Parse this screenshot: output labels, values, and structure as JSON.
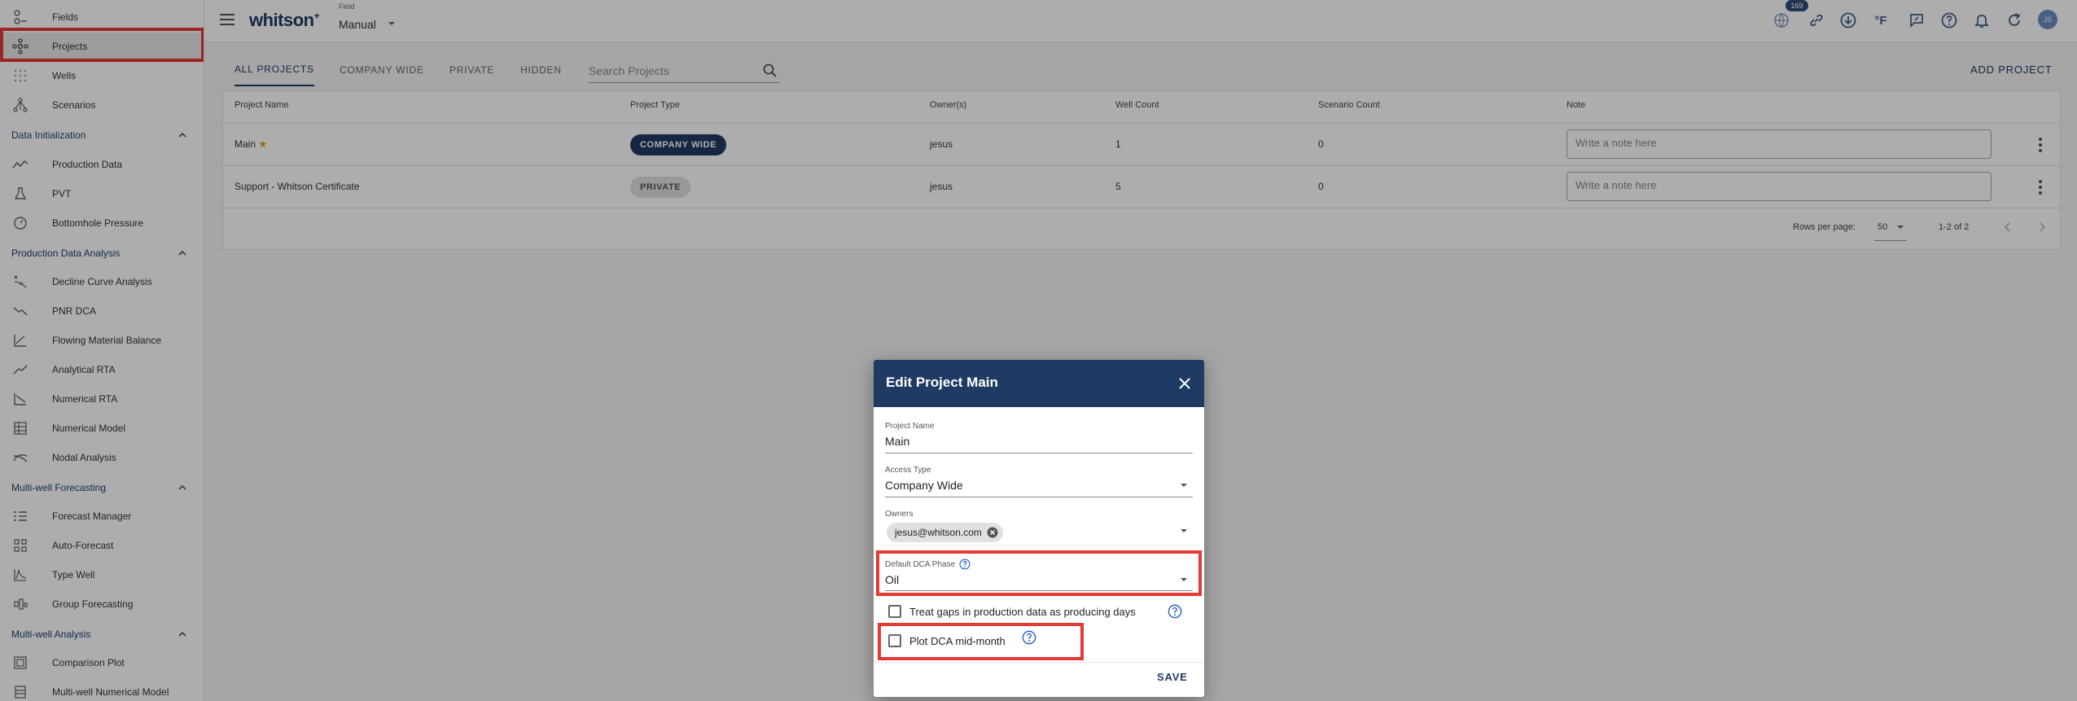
{
  "colors": {
    "primary": "#1f3a63",
    "highlight": "#e53935",
    "star": "#d4a017"
  },
  "sidebar": {
    "top_items": [
      {
        "label": "Fields",
        "icon": "fields-icon"
      },
      {
        "label": "Projects",
        "icon": "projects-icon"
      },
      {
        "label": "Wells",
        "icon": "wells-icon"
      },
      {
        "label": "Scenarios",
        "icon": "scenarios-icon"
      }
    ],
    "sections": [
      {
        "title": "Data Initialization",
        "items": [
          {
            "label": "Production Data",
            "icon": "production-data-icon"
          },
          {
            "label": "PVT",
            "icon": "pvt-flask-icon"
          },
          {
            "label": "Bottomhole Pressure",
            "icon": "pressure-gauge-icon"
          }
        ]
      },
      {
        "title": "Production Data Analysis",
        "items": [
          {
            "label": "Decline Curve Analysis",
            "icon": "decline-curve-icon"
          },
          {
            "label": "PNR DCA",
            "icon": "pnr-dca-icon"
          },
          {
            "label": "Flowing Material Balance",
            "icon": "material-balance-icon"
          },
          {
            "label": "Analytical RTA",
            "icon": "analytical-rta-icon"
          },
          {
            "label": "Numerical RTA",
            "icon": "numerical-rta-icon"
          },
          {
            "label": "Numerical Model",
            "icon": "numerical-model-icon"
          },
          {
            "label": "Nodal Analysis",
            "icon": "nodal-analysis-icon"
          }
        ]
      },
      {
        "title": "Multi-well Forecasting",
        "items": [
          {
            "label": "Forecast Manager",
            "icon": "forecast-manager-icon"
          },
          {
            "label": "Auto-Forecast",
            "icon": "auto-forecast-icon"
          },
          {
            "label": "Type Well",
            "icon": "type-well-icon"
          },
          {
            "label": "Group Forecasting",
            "icon": "group-forecasting-icon"
          }
        ]
      },
      {
        "title": "Multi-well Analysis",
        "items": [
          {
            "label": "Comparison Plot",
            "icon": "comparison-plot-icon"
          },
          {
            "label": "Multi-well Numerical Model",
            "icon": "multiwell-model-icon"
          }
        ]
      }
    ]
  },
  "header": {
    "logo": "whitson",
    "logo_sup": "+",
    "field_caption": "Field",
    "field_value": "Manual",
    "notification_count": "169",
    "temperature_unit": "°F",
    "avatar_initials": "JS"
  },
  "tabs": [
    "ALL PROJECTS",
    "COMPANY WIDE",
    "PRIVATE",
    "HIDDEN"
  ],
  "search": {
    "placeholder": "Search Projects"
  },
  "add_project_label": "ADD PROJECT",
  "table": {
    "columns": [
      "Project Name",
      "Project Type",
      "Owner(s)",
      "Well Count",
      "Scenario Count",
      "Note"
    ],
    "rows": [
      {
        "name": "Main",
        "starred": true,
        "type": "COMPANY WIDE",
        "owner": "jesus",
        "well_count": "1",
        "scenario_count": "0",
        "note_placeholder": "Write a note here"
      },
      {
        "name": "Support - Whitson Certificate",
        "starred": false,
        "type": "PRIVATE",
        "owner": "jesus",
        "well_count": "5",
        "scenario_count": "0",
        "note_placeholder": "Write a note here"
      }
    ],
    "rows_per_page_label": "Rows per page:",
    "rows_per_page": "50",
    "page_range": "1-2 of 2"
  },
  "dialog": {
    "title": "Edit Project Main",
    "project_name_label": "Project Name",
    "project_name_value": "Main",
    "access_type_label": "Access Type",
    "access_type_value": "Company Wide",
    "owners_label": "Owners",
    "owner_chip": "jesus@whitson.com",
    "dca_phase_label": "Default DCA Phase",
    "dca_phase_value": "Oil",
    "treat_gaps_label": "Treat gaps in production data as producing days",
    "plot_midmonth_label": "Plot DCA mid-month",
    "save_label": "SAVE"
  }
}
